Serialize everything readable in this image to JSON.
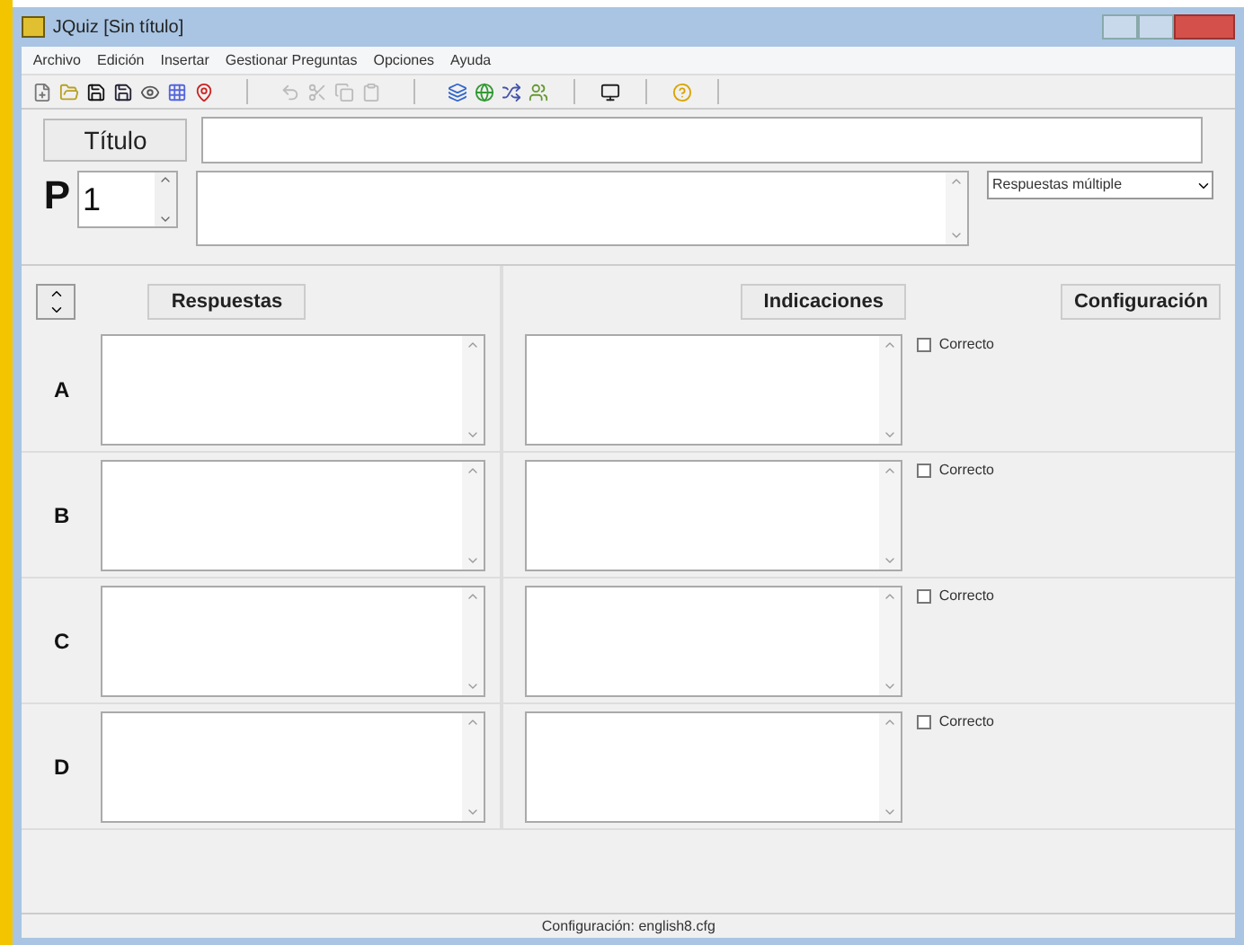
{
  "window": {
    "title": "JQuiz [Sin título]"
  },
  "menu": [
    "Archivo",
    "Edición",
    "Insertar",
    "Gestionar Preguntas",
    "Opciones",
    "Ayuda"
  ],
  "title_field": {
    "label": "Título"
  },
  "question": {
    "label": "P",
    "number": "1",
    "type": "Respuestas múltiple"
  },
  "headers": {
    "answers": "Respuestas",
    "hints": "Indicaciones",
    "config": "Configuración"
  },
  "answers": [
    {
      "letter": "A",
      "correct_label": "Correcto",
      "checked": false
    },
    {
      "letter": "B",
      "correct_label": "Correcto",
      "checked": false
    },
    {
      "letter": "C",
      "correct_label": "Correcto",
      "checked": false
    },
    {
      "letter": "D",
      "correct_label": "Correcto",
      "checked": false
    }
  ],
  "status_bar": "Configuración: english8.cfg"
}
